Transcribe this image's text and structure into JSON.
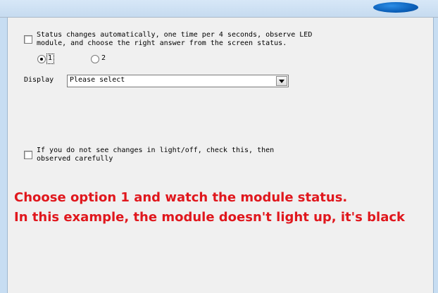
{
  "form": {
    "status_checkbox_label": "Status changes automatically, one time per 4 seconds, observe LED\nmodule, and choose the right answer from the screen status.",
    "radio_options": [
      "1",
      "2"
    ],
    "selected_radio": "1",
    "display_label": "Display",
    "display_select_value": "Please select",
    "observe_checkbox_label": "If you do not see changes in light/off, check this, then\nobserved carefully"
  },
  "annotation": {
    "line1": "Choose option 1 and watch the module status.",
    "line2": "In this example, the module doesn't light up, it's black"
  },
  "colors": {
    "annotation_red": "#e0171d",
    "window_frame_blue": "#c7ddf2",
    "logo_blue": "#0b5fb8"
  }
}
